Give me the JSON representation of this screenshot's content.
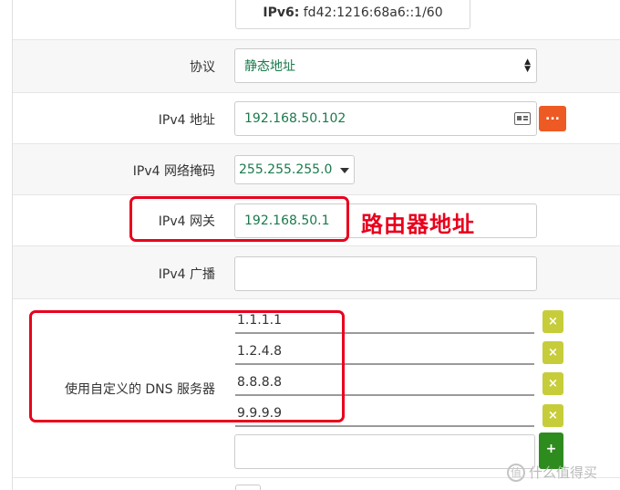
{
  "ipv6": {
    "label": "IPv6:",
    "value": "fd42:1216:68a6::1/60"
  },
  "protocol": {
    "label": "协议",
    "value": "静态地址"
  },
  "ipv4_address": {
    "label": "IPv4 地址",
    "value": "192.168.50.102",
    "more_label": "..."
  },
  "ipv4_netmask": {
    "label": "IPv4 网络掩码",
    "value": "255.255.255.0"
  },
  "ipv4_gateway": {
    "label": "IPv4 网关",
    "value": "192.168.50.1",
    "annotation": "路由器地址"
  },
  "ipv4_broadcast": {
    "label": "IPv4 广播",
    "value": ""
  },
  "dns": {
    "label": "使用自定义的 DNS 服务器",
    "servers": [
      "1.1.1.1",
      "1.2.4.8",
      "8.8.8.8",
      "9.9.9.9"
    ],
    "remove_label": "×",
    "add_label": "+"
  },
  "watermark": {
    "icon": "值",
    "text": "什么值得买"
  },
  "colors": {
    "accent_orange": "#ee5a24",
    "remove_olive": "#c7cd3a",
    "add_green": "#2e8b1e",
    "annotation_red": "#e8001c",
    "value_green": "#1a7a4c"
  },
  "icons": [
    "chevron-updown-icon",
    "id-card-icon",
    "caret-down-icon",
    "close-icon",
    "plus-icon"
  ]
}
